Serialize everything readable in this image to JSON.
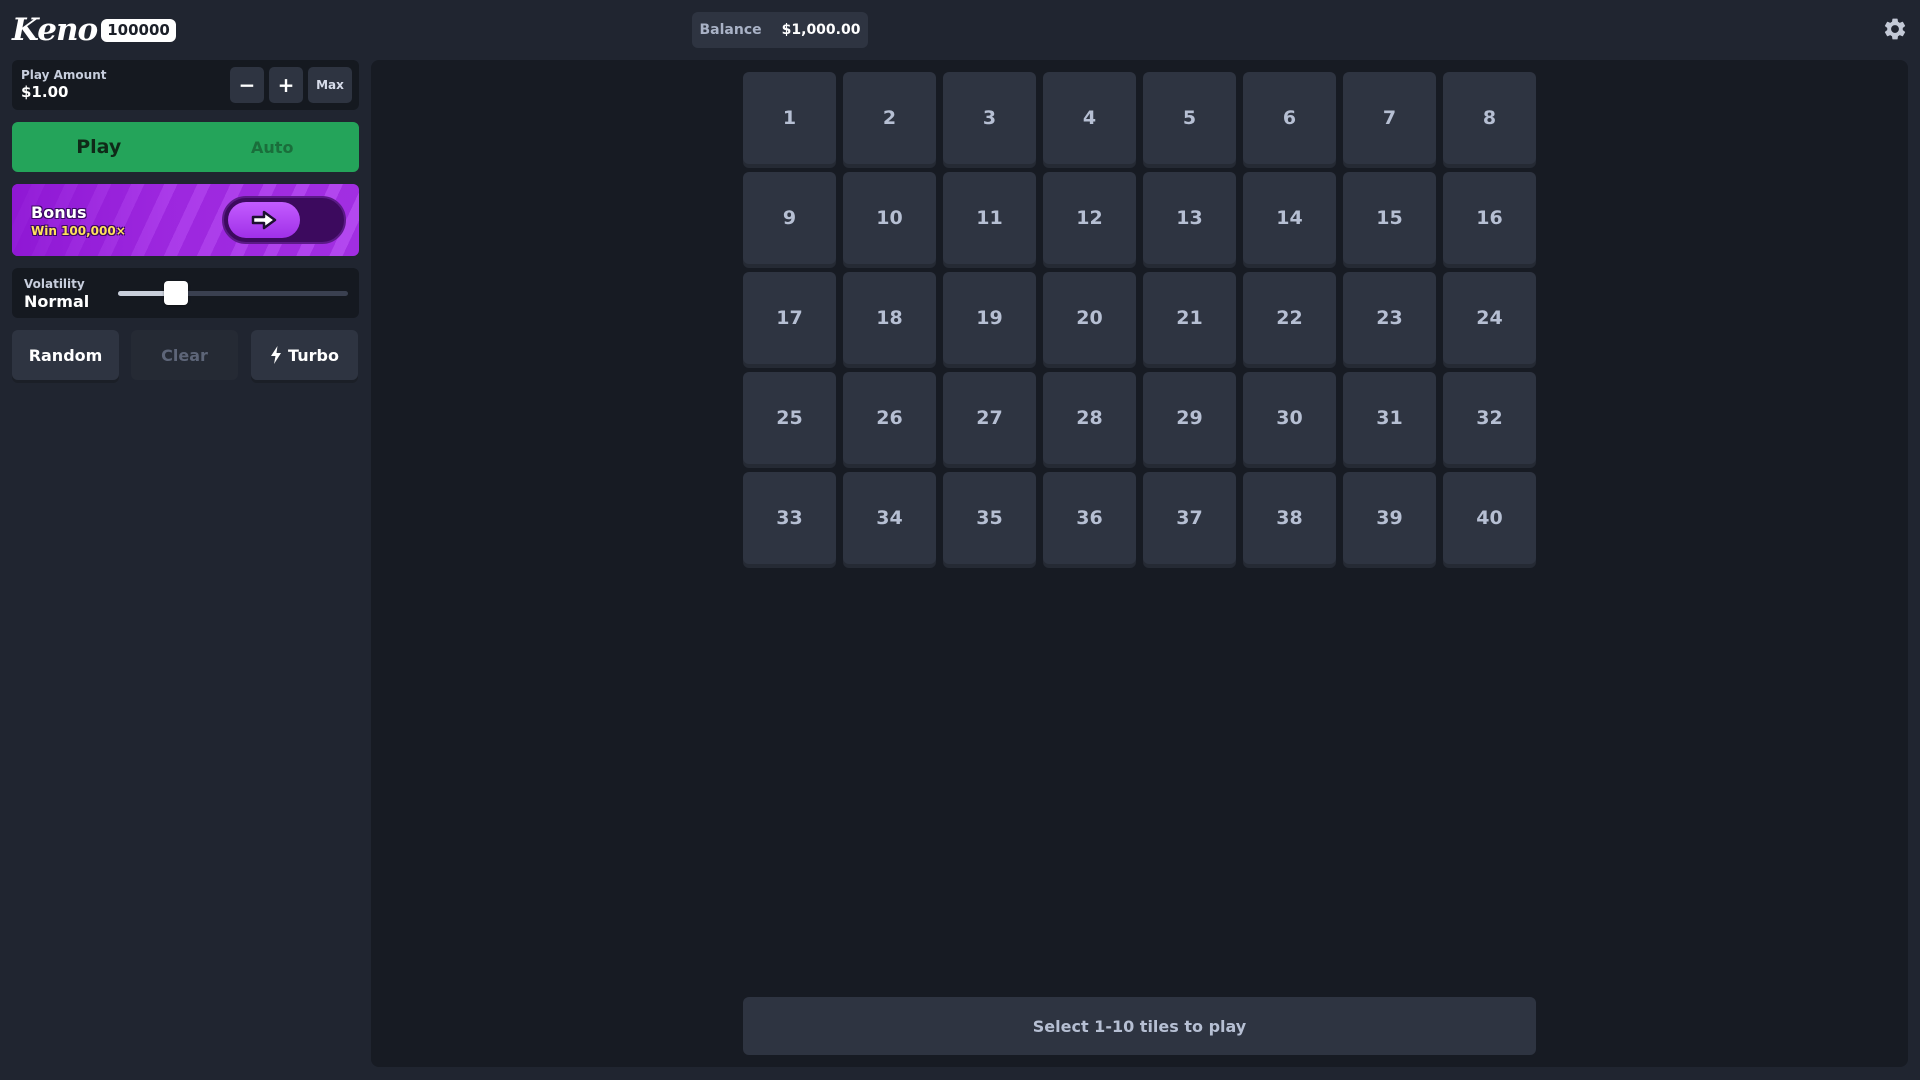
{
  "header": {
    "logo_word": "Keno",
    "logo_badge": "100000",
    "balance_label": "Balance",
    "balance_value": "$1,000.00",
    "settings_icon": "gear-icon"
  },
  "sidebar": {
    "play_amount": {
      "label": "Play Amount",
      "value": "$1.00",
      "minus": "−",
      "plus": "+",
      "max": "Max"
    },
    "modes": {
      "play": "Play",
      "auto": "Auto",
      "active": "play"
    },
    "bonus": {
      "title": "Bonus",
      "subtitle": "Win 100,000×",
      "toggle_icon": "arrow-right-icon"
    },
    "volatility": {
      "label": "Volatility",
      "value": "Normal",
      "level_fraction": 0.25
    },
    "actions": {
      "random": "Random",
      "clear": "Clear",
      "turbo": "Turbo",
      "turbo_icon": "lightning-icon"
    }
  },
  "board": {
    "tiles": [
      "1",
      "2",
      "3",
      "4",
      "5",
      "6",
      "7",
      "8",
      "9",
      "10",
      "11",
      "12",
      "13",
      "14",
      "15",
      "16",
      "17",
      "18",
      "19",
      "20",
      "21",
      "22",
      "23",
      "24",
      "25",
      "26",
      "27",
      "28",
      "29",
      "30",
      "31",
      "32",
      "33",
      "34",
      "35",
      "36",
      "37",
      "38",
      "39",
      "40"
    ],
    "status": "Select 1-10 tiles to play"
  },
  "colors": {
    "background": "#202530",
    "board": "#171b23",
    "tile": "#2e3441",
    "tile_text": "#b6bfd3",
    "play_green": "#24a45a",
    "bonus_purple": "#a02ce0"
  }
}
